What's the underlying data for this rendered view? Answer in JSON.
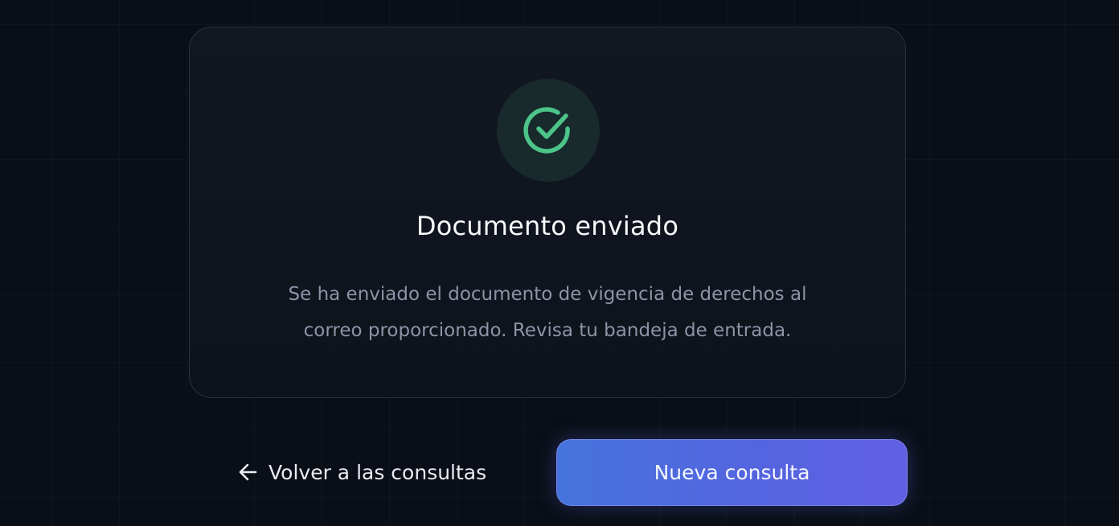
{
  "card": {
    "icon": "check-circle-icon",
    "title": "Documento enviado",
    "message_line1": "Se ha enviado el documento de vigencia de derechos al",
    "message_line2": "correo proporcionado. Revisa tu bandeja de entrada."
  },
  "actions": {
    "back_icon": "arrow-left-icon",
    "back_label": "Volver a las consultas",
    "primary_label": "Nueva consulta"
  },
  "colors": {
    "background": "#0a0e16",
    "card": "#121722",
    "success": "#4cc48a",
    "primary_start": "#4674dc",
    "primary_end": "#6160e2"
  }
}
